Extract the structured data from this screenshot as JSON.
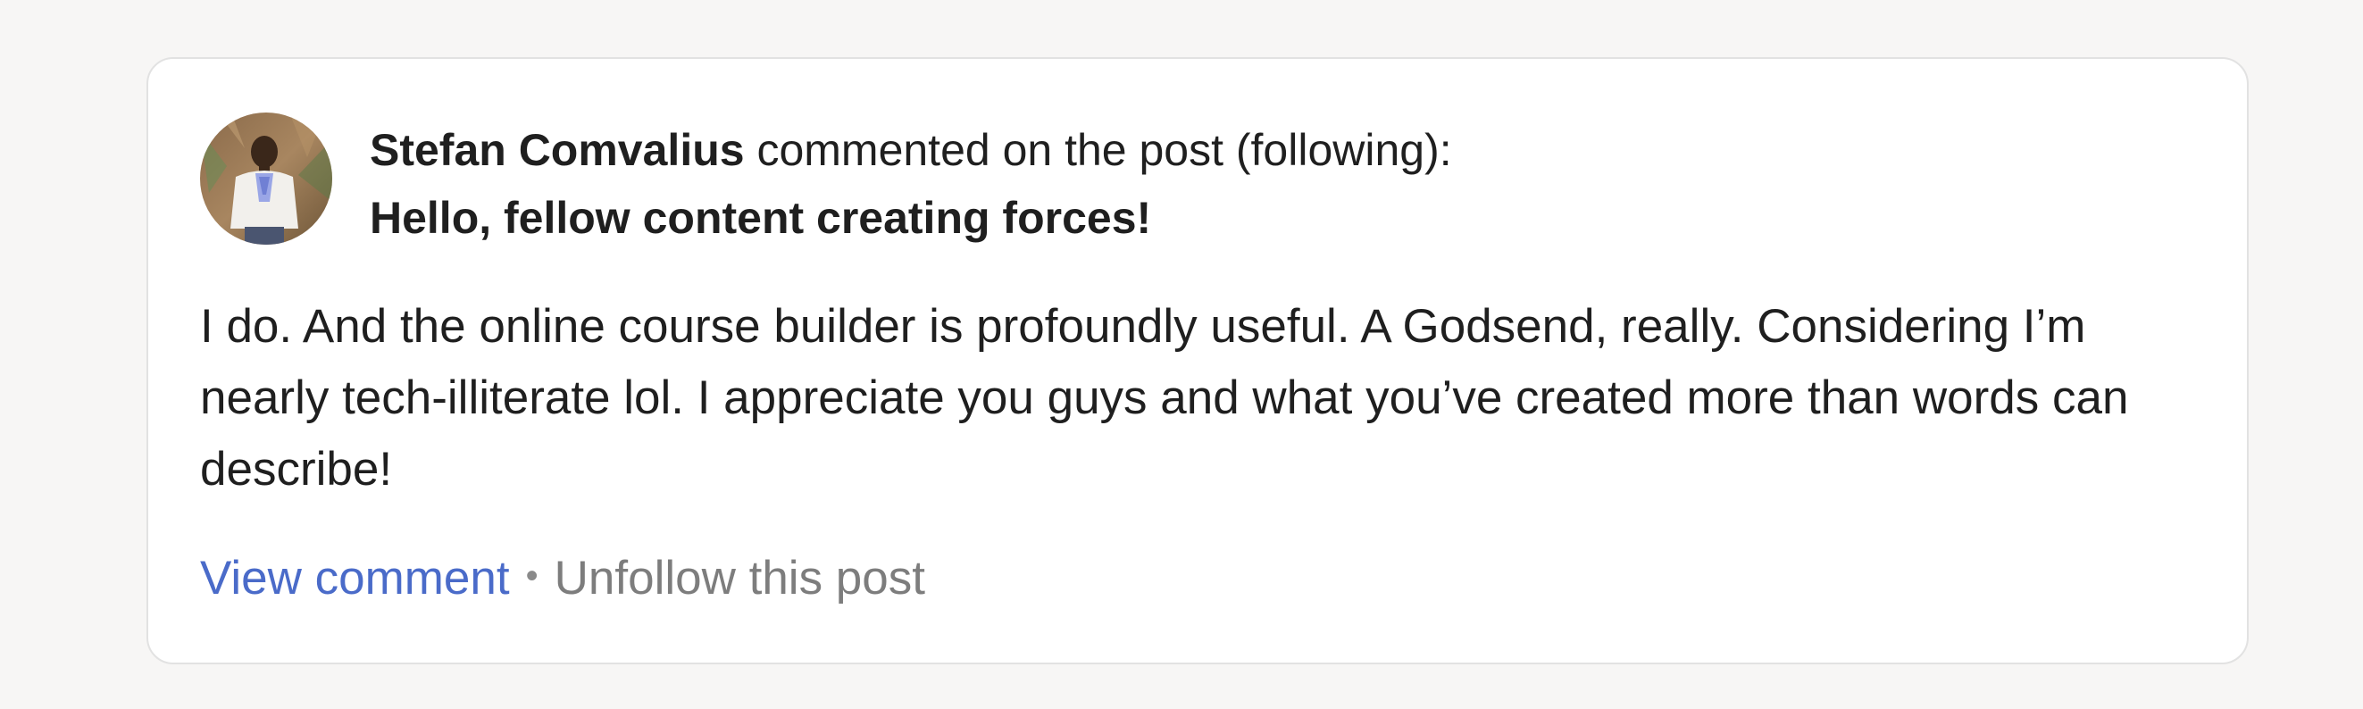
{
  "notification": {
    "author": "Stefan Comvalius",
    "action_text": " commented on the post (following):",
    "post_title": "Hello, fellow content creating forces!",
    "comment_body": "I do. And the online course builder is profoundly useful. A Godsend, really. Considering I’m nearly tech-illiterate lol. I appreciate you guys and what you’ve created more than words can describe!",
    "view_comment_label": "View comment",
    "separator": "•",
    "unfollow_label": "Unfollow this post"
  },
  "colors": {
    "page_background": "#f7f6f5",
    "card_background": "#ffffff",
    "text": "#1f1f1f",
    "link": "#4a6bc9",
    "muted": "#7d7d7d"
  },
  "icons": {
    "avatar": "user-avatar-photo"
  }
}
